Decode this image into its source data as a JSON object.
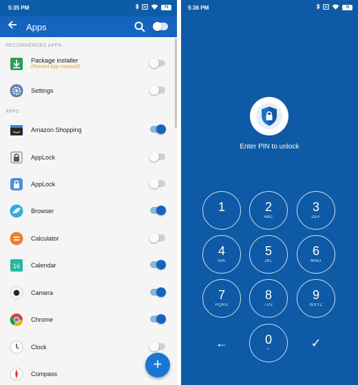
{
  "left": {
    "status": {
      "time": "5:35 PM",
      "battery": "75"
    },
    "appbar": {
      "title": "Apps"
    },
    "sections": {
      "recommended": "RECOMMENDED APPS",
      "apps": "APPS"
    },
    "recommended": [
      {
        "name": "Package installer",
        "sub": "(Prevent App Uninstall)",
        "locked": false,
        "icon": "package-installer-icon"
      },
      {
        "name": "Settings",
        "locked": false,
        "icon": "settings-gear-icon"
      }
    ],
    "apps": [
      {
        "name": "Amazon Shopping",
        "locked": true,
        "icon": "amazon-icon"
      },
      {
        "name": "AppLock",
        "locked": false,
        "icon": "applock-classic-icon"
      },
      {
        "name": "AppLock",
        "locked": false,
        "icon": "applock-padlock-icon"
      },
      {
        "name": "Browser",
        "locked": true,
        "icon": "browser-icon"
      },
      {
        "name": "Calculator",
        "locked": false,
        "icon": "calculator-icon"
      },
      {
        "name": "Calendar",
        "locked": true,
        "icon": "calendar-icon"
      },
      {
        "name": "Camera",
        "locked": true,
        "icon": "camera-icon"
      },
      {
        "name": "Chrome",
        "locked": true,
        "icon": "chrome-icon"
      },
      {
        "name": "Clock",
        "locked": false,
        "icon": "clock-icon"
      },
      {
        "name": "Compass",
        "locked": false,
        "icon": "compass-icon"
      }
    ],
    "calendar_day": "16",
    "fab": "+",
    "accent": "#1565c0"
  },
  "right": {
    "status": {
      "time": "5:36 PM",
      "battery": "75"
    },
    "prompt": "Enter PIN to unlock",
    "keys": [
      {
        "digit": "1",
        "letters": ""
      },
      {
        "digit": "2",
        "letters": "ABC"
      },
      {
        "digit": "3",
        "letters": "DEF"
      },
      {
        "digit": "4",
        "letters": "GHI"
      },
      {
        "digit": "5",
        "letters": "JKL"
      },
      {
        "digit": "6",
        "letters": "MNO"
      },
      {
        "digit": "7",
        "letters": "PQRS"
      },
      {
        "digit": "8",
        "letters": "TUV"
      },
      {
        "digit": "9",
        "letters": "WXYZ"
      },
      {
        "digit": "0",
        "letters": "+"
      }
    ],
    "backspace": "←",
    "confirm": "✓",
    "background": "#0e5aa6"
  }
}
